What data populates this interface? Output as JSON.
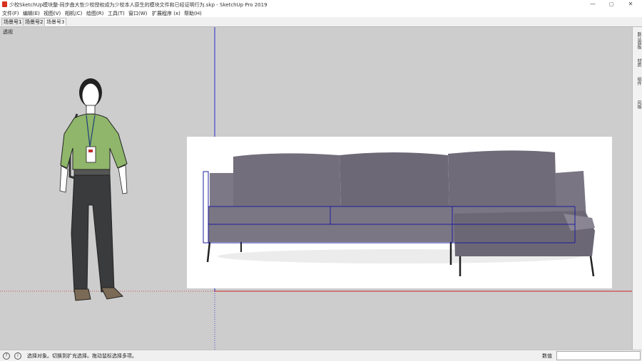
{
  "app": {
    "title": "少校SketchUp模块整-同步曲大哲少校授权成为少校本人原生的模块文件和已经证明行为.skp - SketchUp Pro 2019"
  },
  "window_controls": {
    "minimize": "—",
    "maximize": "▢",
    "close": "✕"
  },
  "menu": [
    {
      "label": "文件(F)"
    },
    {
      "label": "编辑(E)"
    },
    {
      "label": "视图(V)"
    },
    {
      "label": "相机(C)"
    },
    {
      "label": "绘图(R)"
    },
    {
      "label": "工具(T)"
    },
    {
      "label": "窗口(W)"
    },
    {
      "label": "扩展程序 (x)"
    },
    {
      "label": "帮助(H)"
    }
  ],
  "scenes": [
    {
      "label": "场景号1",
      "active": false
    },
    {
      "label": "场景号2",
      "active": false
    },
    {
      "label": "场景号3",
      "active": true
    }
  ],
  "viewport": {
    "label": "透视",
    "axis_colors": {
      "blue": "#2a2ad0",
      "red": "#cc2222",
      "green": "#2a8f2a"
    }
  },
  "tray_tabs": [
    {
      "label": "默认面板"
    },
    {
      "label": "材质"
    },
    {
      "label": "组件"
    },
    {
      "label": "风格"
    }
  ],
  "status": {
    "message": "选择对象。切换到扩充选择。拖动鼠标选择多项。",
    "measurements_label": "数值",
    "measurements_value": ""
  },
  "colors": {
    "sofa_fabric": "#6f6a78",
    "selection_edge": "#1d1d9c",
    "shirt": "#8fb66a",
    "pants": "#3a3b3c",
    "shoes": "#7b6a55"
  }
}
